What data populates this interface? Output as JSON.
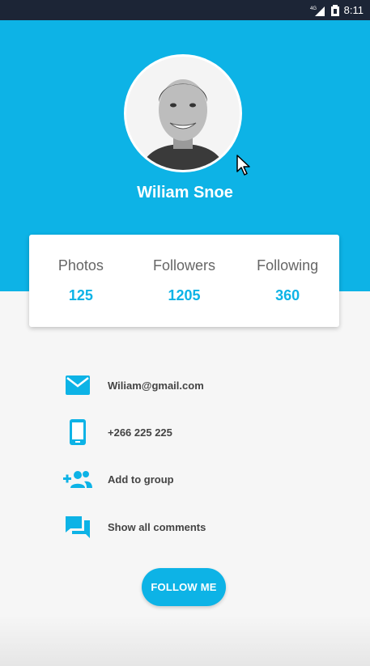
{
  "status_bar": {
    "network_label": "4G",
    "time": "8:11"
  },
  "profile": {
    "name": "Wiliam Snoe"
  },
  "stats": [
    {
      "label": "Photos",
      "value": "125"
    },
    {
      "label": "Followers",
      "value": "1205"
    },
    {
      "label": "Following",
      "value": "360"
    }
  ],
  "info": [
    {
      "icon": "email-icon",
      "text": "Wiliam@gmail.com"
    },
    {
      "icon": "phone-icon",
      "text": "+266 225 225"
    },
    {
      "icon": "add-group-icon",
      "text": "Add to group"
    },
    {
      "icon": "comments-icon",
      "text": "Show all comments"
    }
  ],
  "actions": {
    "follow_label": "FOLLOW ME"
  },
  "colors": {
    "accent": "#0db3e6",
    "status_bar": "#1c2536",
    "background": "#f6f6f6"
  }
}
